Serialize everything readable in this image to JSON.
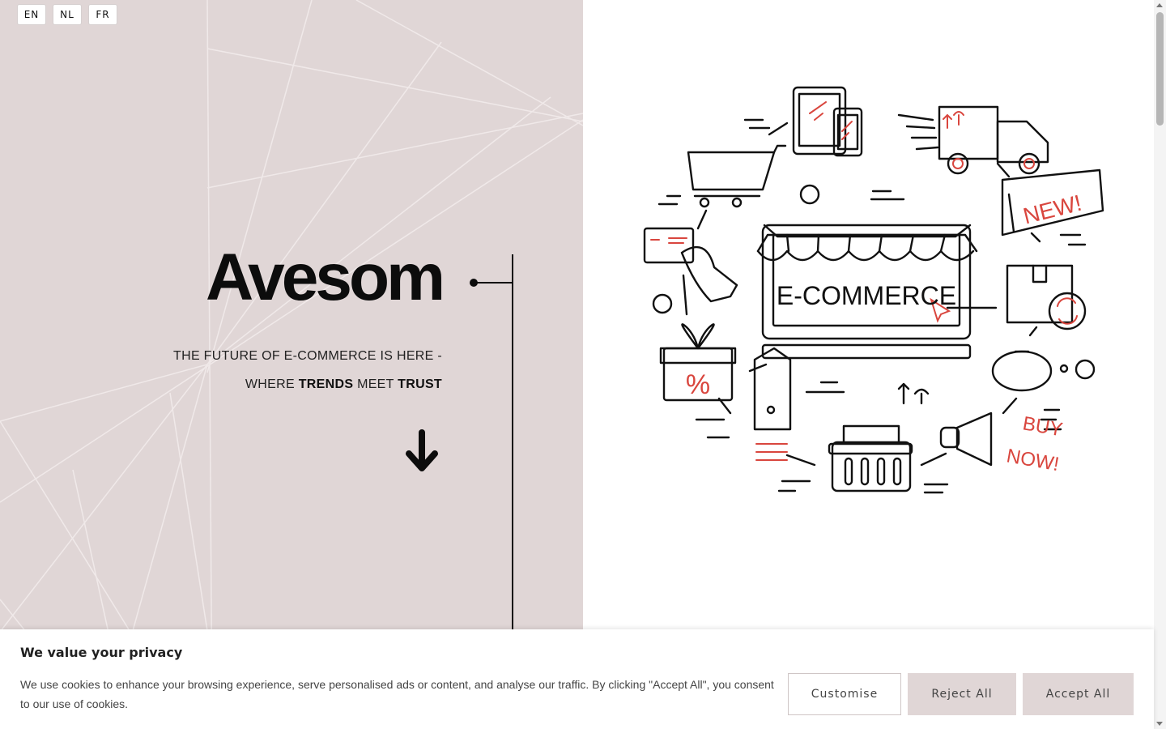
{
  "languages": {
    "en": "EN",
    "nl": "NL",
    "fr": "FR"
  },
  "hero": {
    "title": "Avesom",
    "tagline_line1": "THE FUTURE OF E-COMMERCE IS HERE -",
    "tagline_where": "WHERE",
    "tagline_trends": "TRENDS",
    "tagline_meet": "MEET",
    "tagline_trust": "TRUST",
    "scroll_icon": "arrow-down-icon"
  },
  "illustration": {
    "center_label": "E-COMMERCE",
    "new_label": "NEW!",
    "buy_label": "BUY",
    "now_label": "NOW!",
    "percent_label": "%"
  },
  "cookie": {
    "title": "We value your privacy",
    "text": "We use cookies to enhance your browsing experience, serve personalised ads or content, and analyse our traffic. By clicking \"Accept All\", you consent to our use of cookies.",
    "customise": "Customise",
    "reject": "Reject All",
    "accept": "Accept All"
  },
  "colors": {
    "panel": "#e0d6d6",
    "accent_red": "#d9463e",
    "ink": "#0c0c0c"
  }
}
